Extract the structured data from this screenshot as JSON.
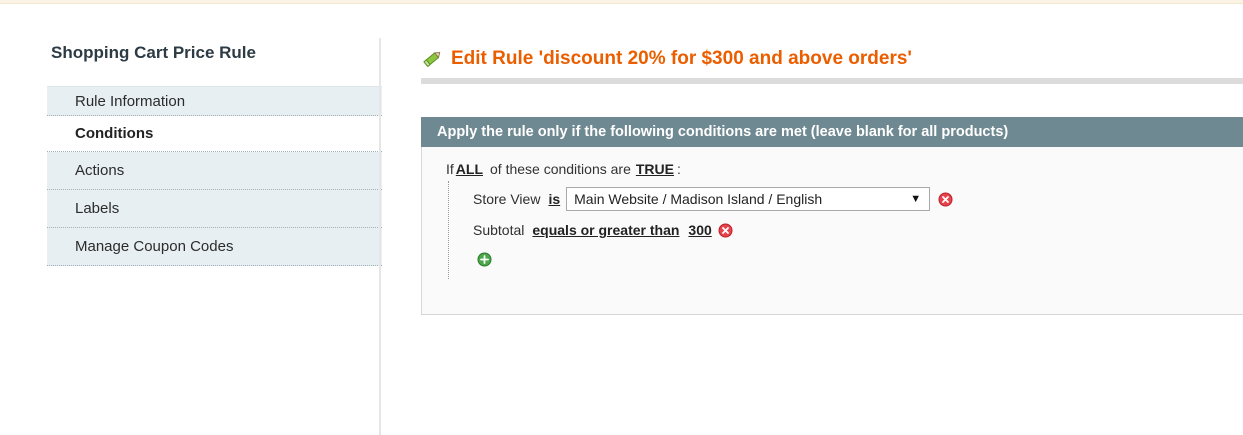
{
  "sidebar": {
    "title": "Shopping Cart Price Rule",
    "items": [
      {
        "label": "Rule Information"
      },
      {
        "label": "Conditions"
      },
      {
        "label": "Actions"
      },
      {
        "label": "Labels"
      },
      {
        "label": "Manage Coupon Codes"
      }
    ],
    "active_index": 1
  },
  "main": {
    "title": "Edit Rule 'discount 20% for $300 and above orders'",
    "title_icon": "pencil-icon",
    "section_legend": "Apply the rule only if the following conditions are met (leave blank for all products)",
    "condition_header": {
      "prefix": "If",
      "aggregator": "ALL",
      "middle": "of these conditions are",
      "value": "TRUE",
      "suffix": ":"
    },
    "conditions": [
      {
        "attribute": "Store View",
        "operator": "is",
        "value": "Main Website / Madison Island / English"
      },
      {
        "attribute": "Subtotal",
        "operator": "equals or greater than",
        "value": "300"
      }
    ]
  },
  "colors": {
    "accent": "#eb5e00",
    "legend_bg": "#6f8992",
    "sidebar_bg": "#e7eff2",
    "remove_icon": "#e8424d",
    "add_icon": "#4aa84a"
  }
}
